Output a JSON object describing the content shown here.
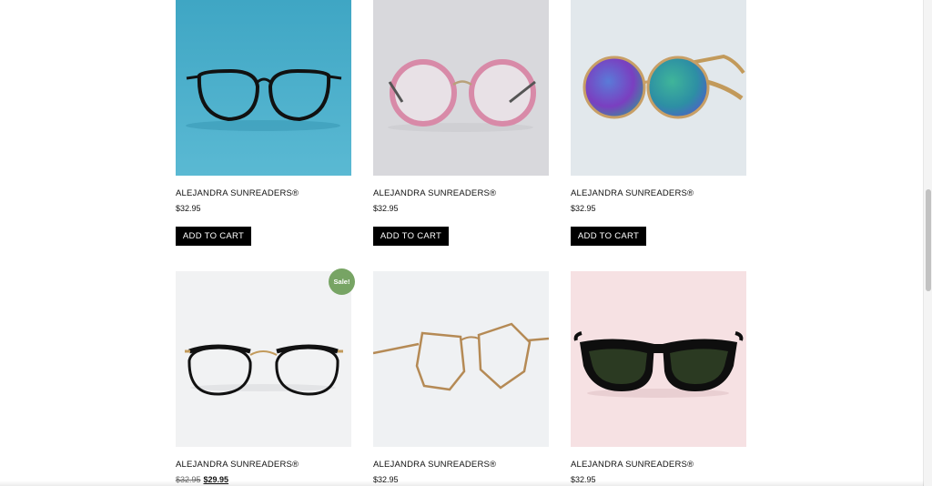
{
  "products": [
    {
      "title": "ALEJANDRA SUNREADERS®",
      "price": "$32.95",
      "button": "ADD TO CART",
      "image_bg": "#4fb0cc",
      "image": "black-eyeglasses-on-blue"
    },
    {
      "title": "ALEJANDRA SUNREADERS®",
      "price": "$32.95",
      "button": "ADD TO CART",
      "image_bg": "#d9d9dd",
      "image": "pink-round-eyeglasses"
    },
    {
      "title": "ALEJANDRA SUNREADERS®",
      "price": "$32.95",
      "button": "ADD TO CART",
      "image_bg": "#e4eaee",
      "image": "round-mirrored-sunglasses"
    },
    {
      "title": "ALEJANDRA SUNREADERS®",
      "price_regular": "$32.95",
      "price_sale": "$29.95",
      "sale_badge": "Sale!",
      "image_bg": "#f1f2f3",
      "image": "black-gold-cateye-eyeglasses"
    },
    {
      "title": "ALEJANDRA SUNREADERS®",
      "price": "$32.95",
      "image_bg": "#eff1f3",
      "image": "gold-wire-eyeglasses"
    },
    {
      "title": "ALEJANDRA SUNREADERS®",
      "price": "$32.95",
      "image_bg": "#f6e1e3",
      "image": "black-sunglasses-on-pink"
    }
  ],
  "colors": {
    "button_bg": "#000000",
    "sale_badge_bg": "#77a464"
  }
}
